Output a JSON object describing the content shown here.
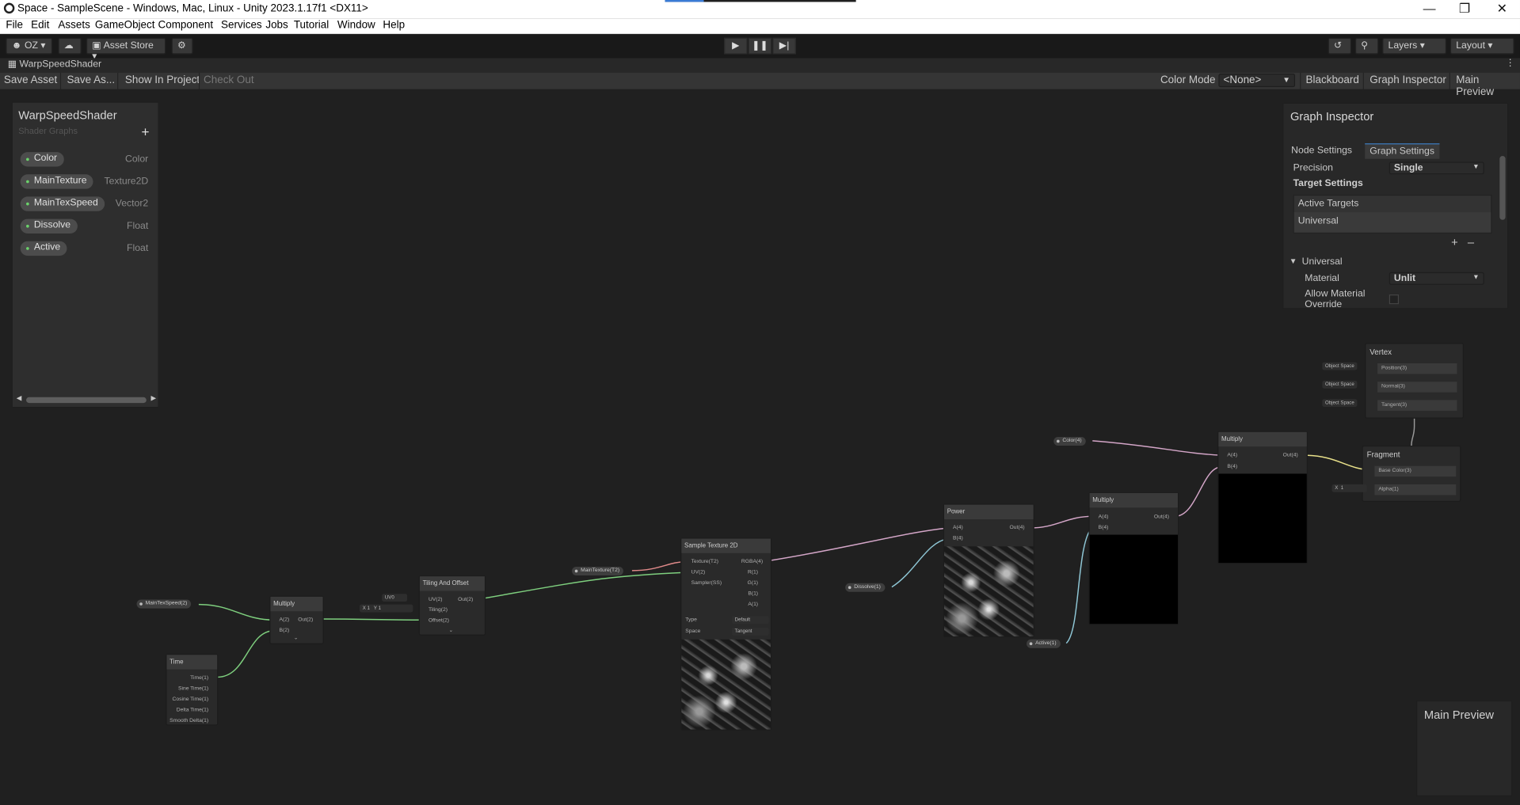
{
  "window": {
    "title": "Space - SampleScene - Windows, Mac, Linux - Unity 2023.1.17f1 <DX11>"
  },
  "menu": [
    "File",
    "Edit",
    "Assets",
    "GameObject",
    "Component",
    "Services",
    "Jobs",
    "Tutorial",
    "Window",
    "Help"
  ],
  "toolbar": {
    "account": "OZ",
    "asset_store": "Asset Store",
    "layers": "Layers",
    "layout": "Layout"
  },
  "tab": {
    "title": "WarpSpeedShader"
  },
  "graph_toolbar": {
    "save_asset": "Save Asset",
    "save_as": "Save As...",
    "show_in_project": "Show In Project",
    "check_out": "Check Out",
    "color_mode_label": "Color Mode",
    "color_mode_value": "<None>",
    "blackboard": "Blackboard",
    "graph_inspector": "Graph Inspector",
    "main_preview": "Main Preview"
  },
  "blackboard": {
    "title": "WarpSpeedShader",
    "subtitle": "Shader Graphs",
    "properties": [
      {
        "name": "Color",
        "type": "Color"
      },
      {
        "name": "MainTexture",
        "type": "Texture2D"
      },
      {
        "name": "MainTexSpeed",
        "type": "Vector2"
      },
      {
        "name": "Dissolve",
        "type": "Float"
      },
      {
        "name": "Active",
        "type": "Float"
      }
    ]
  },
  "inspector": {
    "title": "Graph Inspector",
    "tab_node": "Node Settings",
    "tab_graph": "Graph Settings",
    "precision_label": "Precision",
    "precision_value": "Single",
    "target_settings": "Target Settings",
    "active_targets": "Active Targets",
    "target_universal": "Universal",
    "universal_section": "Universal",
    "material_label": "Material",
    "material_value": "Unlit",
    "allow_override": "Allow Material Override"
  },
  "nodes": {
    "vertex": {
      "title": "Vertex",
      "ports": [
        "Position(3)",
        "Normal(3)",
        "Tangent(3)"
      ],
      "space": "Object Space"
    },
    "fragment": {
      "title": "Fragment",
      "ports": [
        "Base Color(3)",
        "Alpha(1)"
      ],
      "alpha_x": "X",
      "alpha_value": "1"
    },
    "multiply_final": {
      "title": "Multiply",
      "in": [
        "A(4)",
        "B(4)"
      ],
      "out": "Out(4)"
    },
    "multiply_mid": {
      "title": "Multiply",
      "in": [
        "A(4)",
        "B(4)"
      ],
      "out": "Out(4)"
    },
    "power": {
      "title": "Power",
      "in": [
        "A(4)",
        "B(4)"
      ],
      "out": "Out(4)"
    },
    "sample": {
      "title": "Sample Texture 2D",
      "in": [
        "Texture(T2)",
        "UV(2)",
        "Sampler(SS)"
      ],
      "out": [
        "RGBA(4)",
        "R(1)",
        "G(1)",
        "B(1)",
        "A(1)"
      ],
      "type_label": "Type",
      "type_value": "Default",
      "space_label": "Space",
      "space_value": "Tangent"
    },
    "tiling": {
      "title": "Tiling And Offset",
      "in": [
        "UV(2)",
        "Tiling(2)",
        "Offset(2)"
      ],
      "out": "Out(2)",
      "uv_value": "UV0",
      "x": "X",
      "x_val": "1",
      "y": "Y",
      "y_val": "1"
    },
    "multiply_left": {
      "title": "Multiply",
      "in": [
        "A(2)",
        "B(2)"
      ],
      "out": "Out(2)"
    },
    "time": {
      "title": "Time",
      "out": [
        "Time(1)",
        "Sine Time(1)",
        "Cosine Time(1)",
        "Delta Time(1)",
        "Smooth Delta(1)"
      ]
    }
  },
  "props_in_graph": {
    "color": "Color(4)",
    "main_texture": "MainTexture(T2)",
    "main_tex_speed": "MainTexSpeed(2)",
    "dissolve": "Dissolve(1)",
    "active": "Active(1)"
  },
  "main_preview": {
    "title": "Main Preview"
  },
  "colors": {
    "accent": "#3a79bb",
    "edge_green": "#7ecf7e",
    "edge_pink": "#d4a6c8",
    "edge_blue": "#8fc7d6"
  }
}
